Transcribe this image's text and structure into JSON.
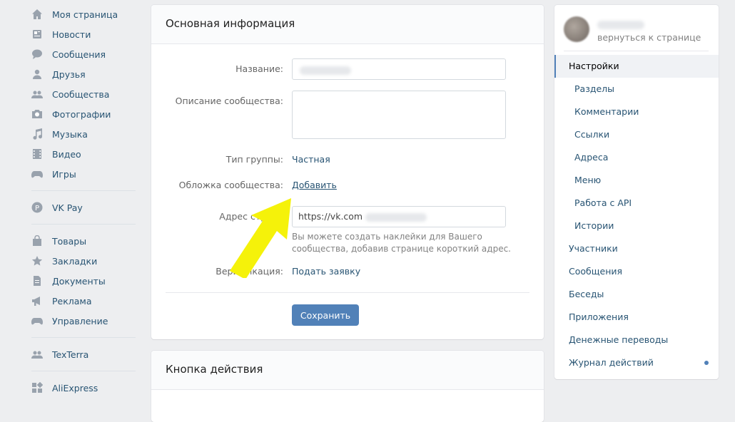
{
  "left_nav": {
    "group1": [
      {
        "label": "Моя страница",
        "icon": "home-icon"
      },
      {
        "label": "Новости",
        "icon": "news-icon"
      },
      {
        "label": "Сообщения",
        "icon": "messages-icon"
      },
      {
        "label": "Друзья",
        "icon": "friends-icon"
      },
      {
        "label": "Сообщества",
        "icon": "communities-icon"
      },
      {
        "label": "Фотографии",
        "icon": "photos-icon"
      },
      {
        "label": "Музыка",
        "icon": "music-icon"
      },
      {
        "label": "Видео",
        "icon": "video-icon"
      },
      {
        "label": "Игры",
        "icon": "games-icon"
      }
    ],
    "group2": [
      {
        "label": "VK Pay",
        "icon": "vkpay-icon"
      }
    ],
    "group3": [
      {
        "label": "Товары",
        "icon": "goods-icon"
      },
      {
        "label": "Закладки",
        "icon": "star-icon"
      },
      {
        "label": "Документы",
        "icon": "documents-icon"
      },
      {
        "label": "Реклама",
        "icon": "ads-icon"
      },
      {
        "label": "Управление",
        "icon": "gamepad-icon"
      }
    ],
    "group4": [
      {
        "label": "TexTerra",
        "icon": "community-icon"
      }
    ],
    "group5": [
      {
        "label": "AliExpress",
        "icon": "apps-icon"
      }
    ]
  },
  "main": {
    "title": "Основная информация",
    "name_label": "Название:",
    "description_label": "Описание сообщества:",
    "group_type_label": "Тип группы:",
    "group_type_value": "Частная",
    "cover_label": "Обложка сообщества:",
    "cover_link": "Добавить",
    "address_label": "Адрес страни",
    "address_value": "https://vk.com",
    "address_hint": "Вы можете создать наклейки для Вашего сообщества, добавив странице короткий адрес.",
    "verification_label": "Верификация:",
    "verification_link": "Подать заявку",
    "save_label": "Сохранить"
  },
  "action_card": {
    "title": "Кнопка действия"
  },
  "right_menu": {
    "back_label": "вернуться к странице",
    "items": [
      {
        "label": "Настройки",
        "active": true,
        "sub": false
      },
      {
        "label": "Разделы",
        "sub": true
      },
      {
        "label": "Комментарии",
        "sub": true
      },
      {
        "label": "Ссылки",
        "sub": true
      },
      {
        "label": "Адреса",
        "sub": true
      },
      {
        "label": "Меню",
        "sub": true
      },
      {
        "label": "Работа с API",
        "sub": true
      },
      {
        "label": "Истории",
        "sub": true
      },
      {
        "label": "Участники",
        "sub": false
      },
      {
        "label": "Сообщения",
        "sub": false
      },
      {
        "label": "Беседы",
        "sub": false
      },
      {
        "label": "Приложения",
        "sub": false
      },
      {
        "label": "Денежные переводы",
        "sub": false
      },
      {
        "label": "Журнал действий",
        "sub": false,
        "dot": true
      }
    ]
  },
  "colors": {
    "accent": "#5181b8",
    "link": "#285473",
    "arrow": "#f5f20a"
  }
}
